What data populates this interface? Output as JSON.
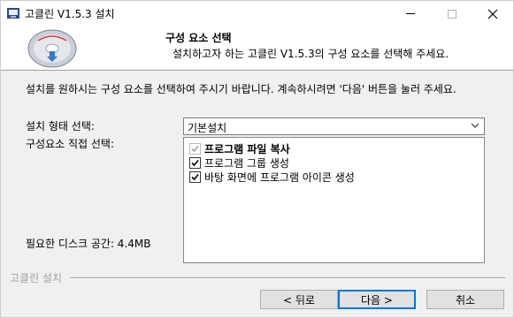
{
  "window": {
    "title": "고클린 V1.5.3 설치"
  },
  "header": {
    "title": "구성 요소 선택",
    "subtitle": "설치하고자 하는 고클린 V1.5.3의 구성 요소를 선택해 주세요."
  },
  "body": {
    "description": "설치를 원하시는 구성 요소를 선택하여 주시기 바랍니다. 계속하시려면 '다음' 버튼을 눌러 주세요.",
    "install_type_label": "설치 형태 선택:",
    "install_type_value": "기본설치",
    "components_label": "구성요소 직접 선택:",
    "disk_space_label": "필요한 디스크 공간: 4.4MB",
    "components": [
      {
        "label": "프로그램 파일 복사",
        "checked": true,
        "disabled": true
      },
      {
        "label": "프로그램 그룹 생성",
        "checked": true,
        "disabled": false
      },
      {
        "label": "바탕 화면에 프로그램 아이콘 생성",
        "checked": true,
        "disabled": false
      }
    ]
  },
  "footer": {
    "brand": "고클린 설치",
    "back_label": "< 뒤로",
    "next_label": "다음 >",
    "cancel_label": "취소"
  },
  "colors": {
    "accent": "#0078d7",
    "check": "#000000",
    "check_disabled": "#a0a0a0"
  }
}
